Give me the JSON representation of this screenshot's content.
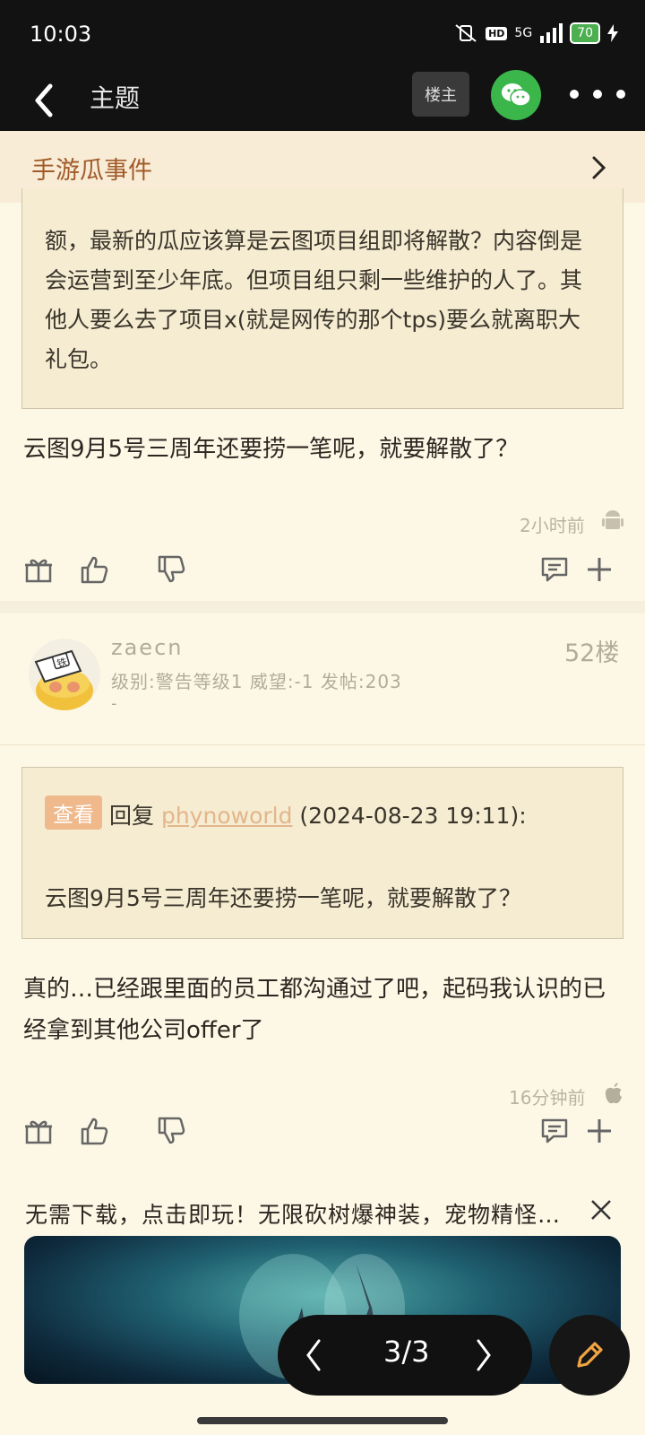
{
  "status": {
    "time": "10:03",
    "network": "5G",
    "hd": "HD",
    "battery": "70"
  },
  "nav": {
    "title": "主题",
    "owner_button": "楼主"
  },
  "category": {
    "label": "手游瓜事件"
  },
  "post1": {
    "quote_text": "额，最新的瓜应该算是云图项目组即将解散？内容倒是会运营到至少年底。但项目组只剩一些维护的人了。其他人要么去了项目x(就是网传的那个tps)要么就离职大礼包。",
    "reply_text": "云图9月5号三周年还要捞一笔呢，就要解散了？",
    "time": "2小时前"
  },
  "post2": {
    "username": "zaecn",
    "user_info": "级别:警告等级1 威望:-1 发帖:203",
    "user_extra": "-",
    "floor": "52楼",
    "view_button": "查看",
    "reply_prefix": "回复",
    "reply_user": "phynoworld",
    "reply_date": "(2024-08-23 19:11):",
    "quote_text": "云图9月5号三周年还要捞一笔呢，就要解散了？",
    "body": "真的…已经跟里面的员工都沟通过了吧，起码我认识的已经拿到其他公司offer了",
    "time": "16分钟前"
  },
  "ad": {
    "text": "无需下载，点击即玩！无限砍树爆神装，宠物精怪…"
  },
  "pager": {
    "label": "3/3"
  },
  "colors": {
    "background": "#fdf8e6",
    "category_text": "#a15b2a",
    "wechat_green": "#3bb64a",
    "view_button": "#f0b98b"
  },
  "icons": [
    "back-icon",
    "wechat-icon",
    "more-icon",
    "chevron-right-icon",
    "gift-icon",
    "thumbs-up-icon",
    "thumbs-down-icon",
    "comment-icon",
    "plus-icon",
    "android-icon",
    "apple-icon",
    "close-icon",
    "edit-icon"
  ]
}
